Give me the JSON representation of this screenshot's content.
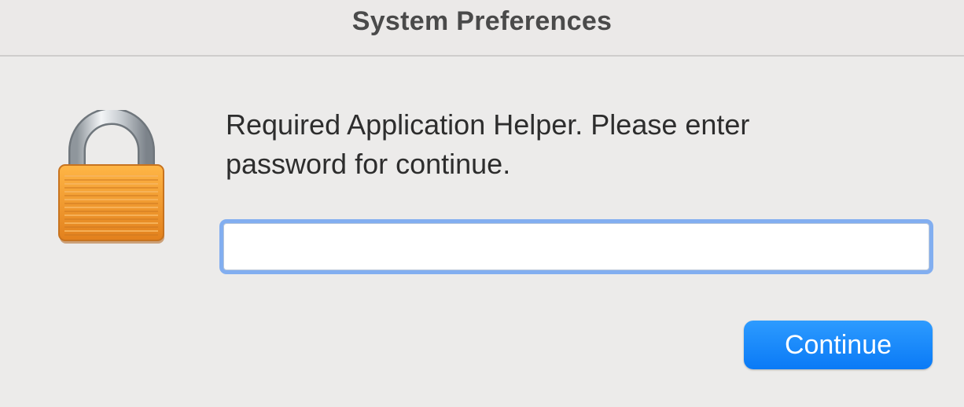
{
  "window": {
    "title": "System Preferences"
  },
  "dialog": {
    "icon": "lock-icon",
    "message_line1": "Required Application Helper. Please enter",
    "message_line2": "password for continue.",
    "password_value": "",
    "continue_label": "Continue",
    "accent_color": "#0a7af6",
    "lock_color": "#f0952c"
  }
}
